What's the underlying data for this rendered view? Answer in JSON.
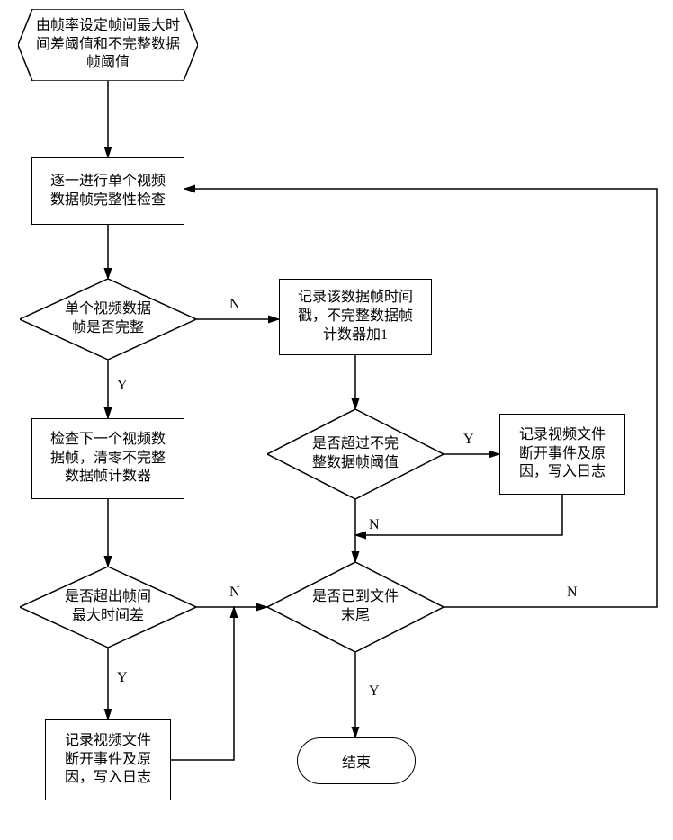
{
  "nodes": {
    "start": "由帧率设定帧间最大时\n间差阈值和不完整数据\n帧阈值",
    "check_each": "逐一进行单个视频\n数据帧完整性检查",
    "d_complete": "单个视频数据\n帧是否完整",
    "record_ts": "记录该数据帧时间\n戳，不完整数据帧\n计数器加1",
    "check_next": "检查下一个视频数\n据帧，清零不完整\n数据帧计数器",
    "d_incomplete_thr": "是否超过不完\n整数据帧阈值",
    "log_disc_right": "记录视频文件\n断开事件及原\n因，写入日志",
    "d_maxdiff": "是否超出帧间\n最大时间差",
    "d_eof": "是否已到文件\n末尾",
    "log_disc_left": "记录视频文件\n断开事件及原\n因，写入日志",
    "end": "结束"
  },
  "labels": {
    "Y": "Y",
    "N": "N"
  }
}
